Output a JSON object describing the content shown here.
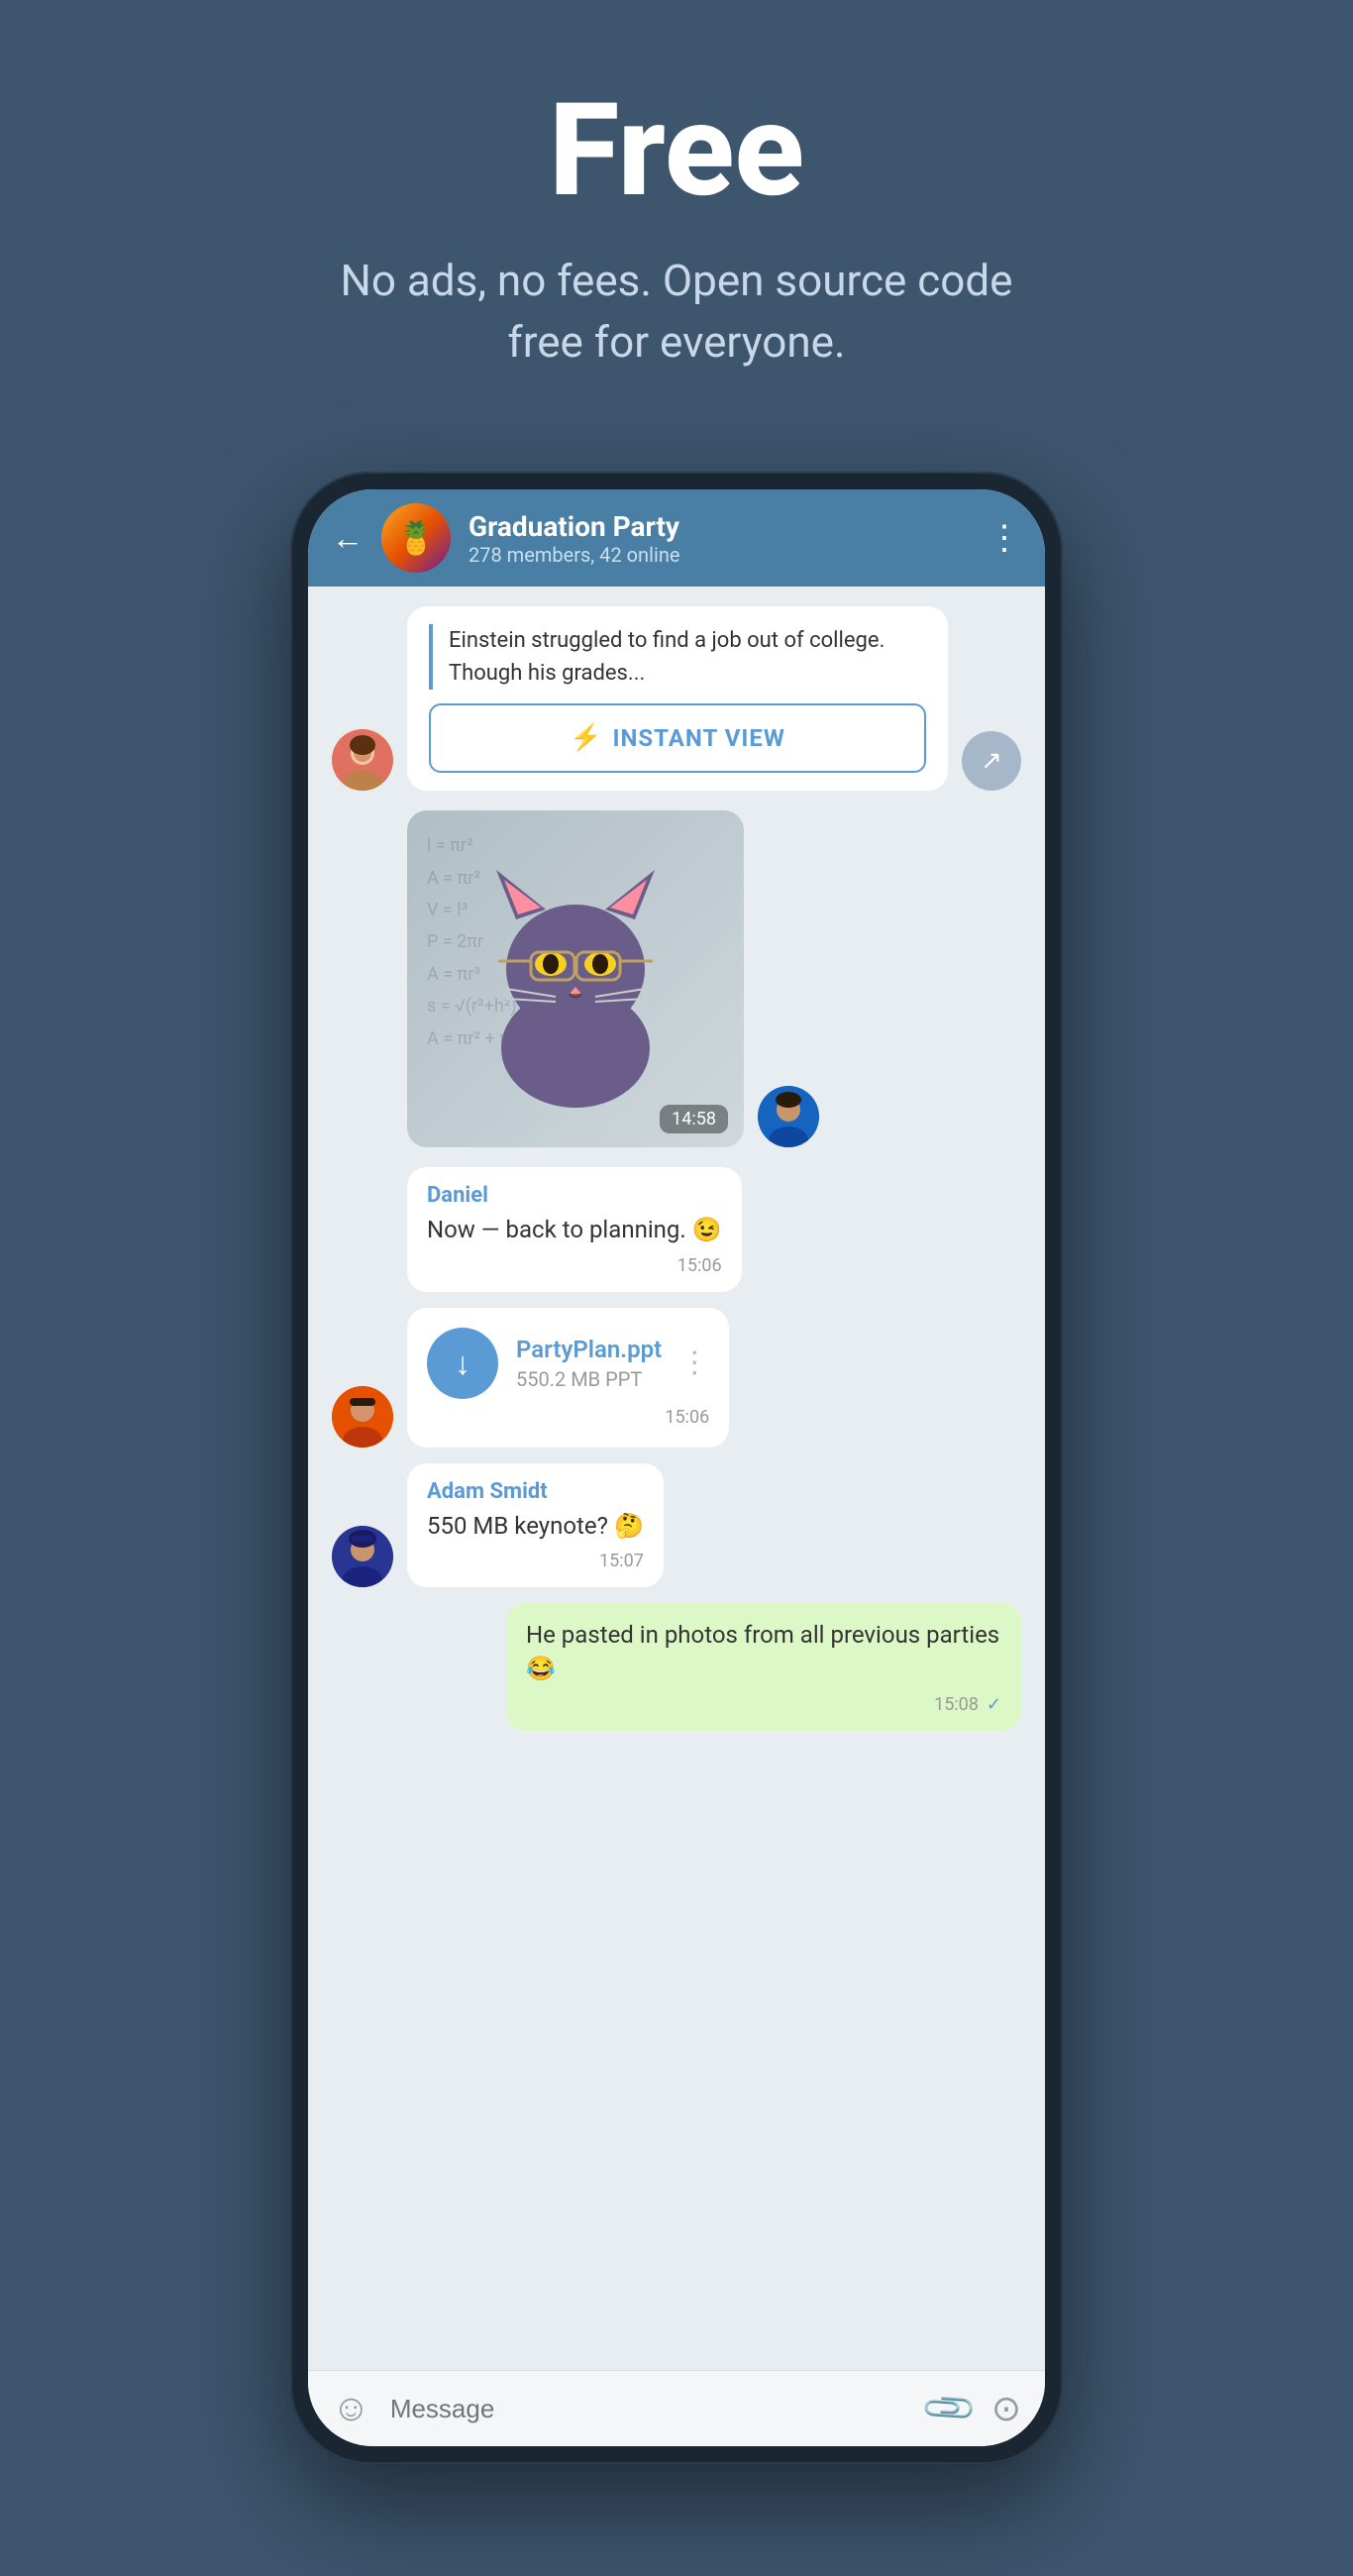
{
  "hero": {
    "title": "Free",
    "subtitle": "No ads, no fees. Open source code free for everyone."
  },
  "header": {
    "group_name": "Graduation Party",
    "group_members": "278 members, 42 online",
    "group_emoji": "🍍"
  },
  "article": {
    "text": "Einstein struggled to find a job out of college. Though his grades...",
    "instant_view_label": "INSTANT VIEW"
  },
  "sticker": {
    "time": "14:58"
  },
  "messages": [
    {
      "sender": "Daniel",
      "text": "Now — back to planning. 😉",
      "time": "15:06",
      "type": "white"
    },
    {
      "sender": "",
      "file_name": "PartyPlan.ppt",
      "file_size": "550.2 MB PPT",
      "time": "15:06",
      "type": "file"
    },
    {
      "sender": "Adam Smidt",
      "text": "550 MB keynote? 🤔",
      "time": "15:07",
      "type": "white"
    },
    {
      "sender": "",
      "text": "He pasted in photos from all previous parties 😂",
      "time": "15:08",
      "type": "green",
      "checked": true
    }
  ],
  "input": {
    "placeholder": "Message"
  }
}
